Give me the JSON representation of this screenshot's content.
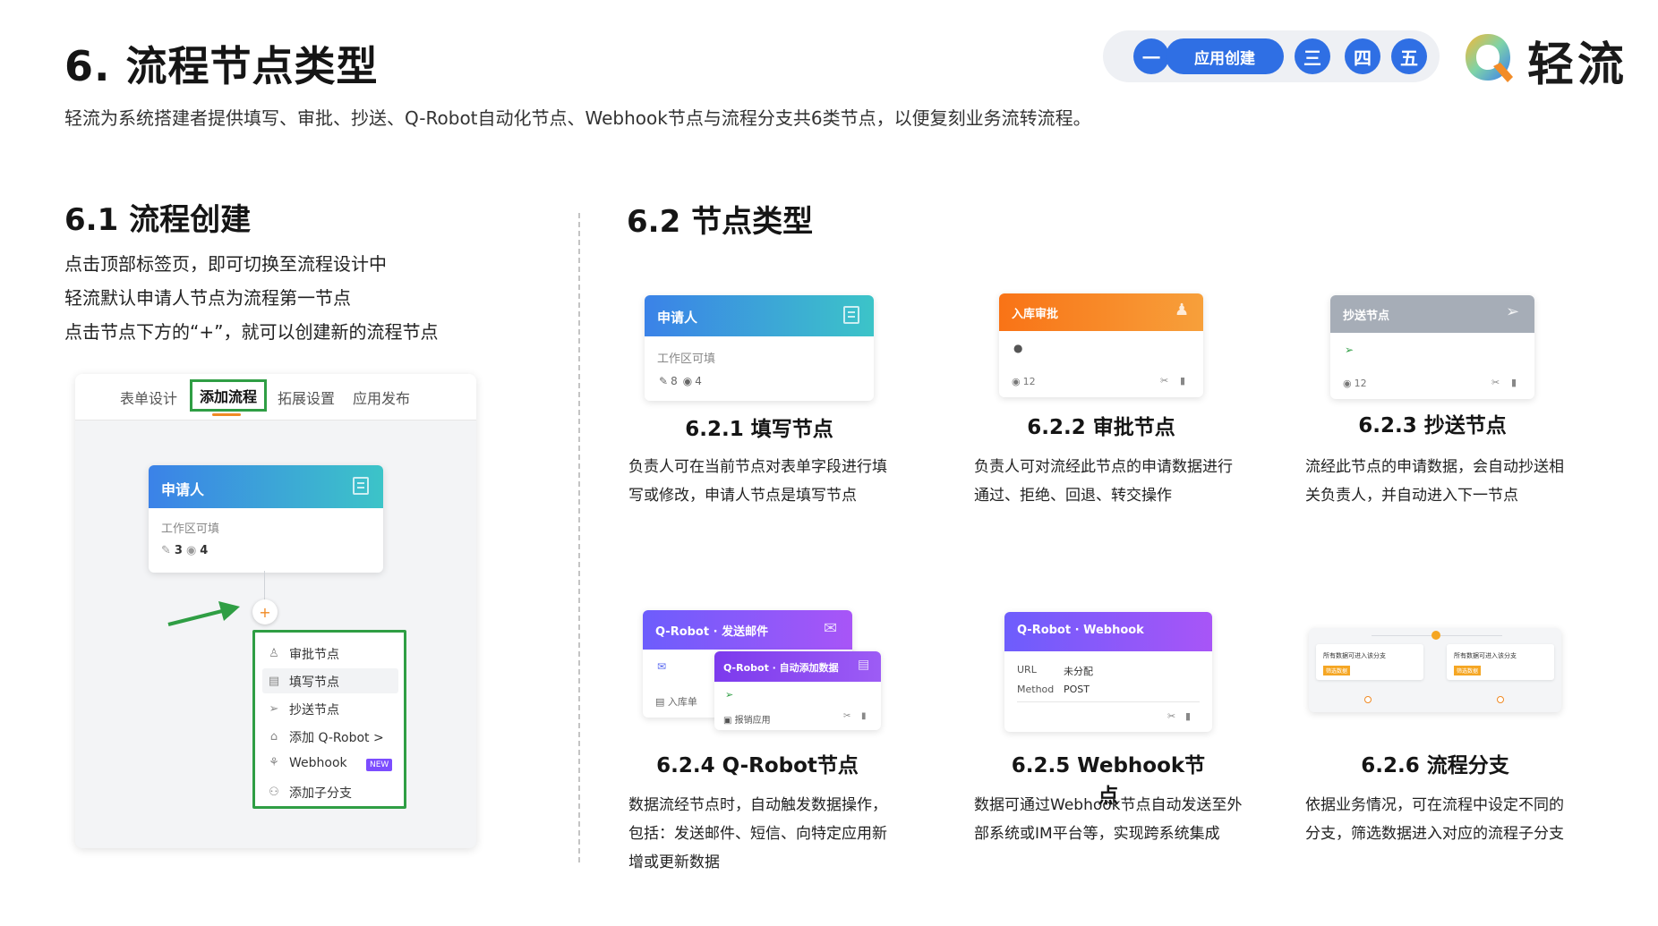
{
  "header": {
    "title": "6. 流程节点类型",
    "description": "轻流为系统搭建者提供填写、审批、抄送、Q-Robot自动化节点、Webhook节点与流程分支共6类节点，以便复刻业务流转流程。",
    "steps": [
      "一",
      "应用创建",
      "三",
      "四",
      "五"
    ],
    "logo_text": "轻流",
    "colors": {
      "accent": "#2f6fe4",
      "nav_bg": "#eef0f4"
    }
  },
  "section1": {
    "title": "6.1 流程创建",
    "lines": [
      "点击顶部标签页，即可切换至流程设计中",
      "轻流默认申请人节点为流程第一节点",
      "点击节点下方的“+”，就可以创建新的流程节点"
    ],
    "mock": {
      "tabs": [
        "表单设计",
        "添加流程",
        "拓展设置",
        "应用发布"
      ],
      "active_tab": "添加流程",
      "node": {
        "title": "申请人",
        "subtitle": "工作区可填",
        "edit_count": "3",
        "view_count": "4"
      },
      "menu": [
        "审批节点",
        "填写节点",
        "抄送节点",
        "添加 Q-Robot >",
        "Webhook",
        "添加子分支"
      ],
      "menu_badge": "NEW",
      "plus": "+"
    }
  },
  "section2": {
    "title": "6.2 节点类型",
    "items": [
      {
        "title": "6.2.1 填写节点",
        "desc": [
          "负责人可在当前节点对表单字段进行填",
          "写或修改，申请人节点是填写节点"
        ],
        "card": {
          "head": "申请人",
          "sub": "工作区可填",
          "edit": "8",
          "view": "4"
        }
      },
      {
        "title": "6.2.2 审批节点",
        "desc": [
          "负责人可对流经此节点的申请数据进行",
          "通过、拒绝、回退、转交操作"
        ],
        "card": {
          "head": "入库审批",
          "view": "12"
        }
      },
      {
        "title": "6.2.3 抄送节点",
        "desc": [
          "流经此节点的申请数据，会自动抄送相",
          "关负责人，并自动进入下一节点"
        ],
        "card": {
          "head": "抄送节点",
          "view": "12"
        }
      },
      {
        "title": "6.2.4 Q-Robot节点",
        "desc": [
          "数据流经节点时，自动触发数据操作，",
          "包括：发送邮件、短信、向特定应用新",
          "增或更新数据"
        ],
        "card": {
          "head": "Q-Robot · 发送邮件",
          "sub": "入库单",
          "head2": "Q-Robot · 自动添加数据",
          "sub2": "报销应用"
        }
      },
      {
        "title": "6.2.5 Webhook节点",
        "desc": [
          "数据可通过Webhook节点自动发送至外",
          "部系统或IM平台等，实现跨系统集成"
        ],
        "card": {
          "head": "Q-Robot · Webhook",
          "url_label": "URL",
          "url_value": "未分配",
          "method_label": "Method",
          "method_value": "POST"
        }
      },
      {
        "title": "6.2.6 流程分支",
        "desc": [
          "依据业务情况，可在流程中设定不同的",
          "分支，筛选数据进入对应的流程子分支"
        ],
        "card": {
          "branch_a": "所有数据可进入该分支",
          "branch_b": "所有数据可进入该分支",
          "tag": "筛选数据"
        }
      }
    ]
  }
}
